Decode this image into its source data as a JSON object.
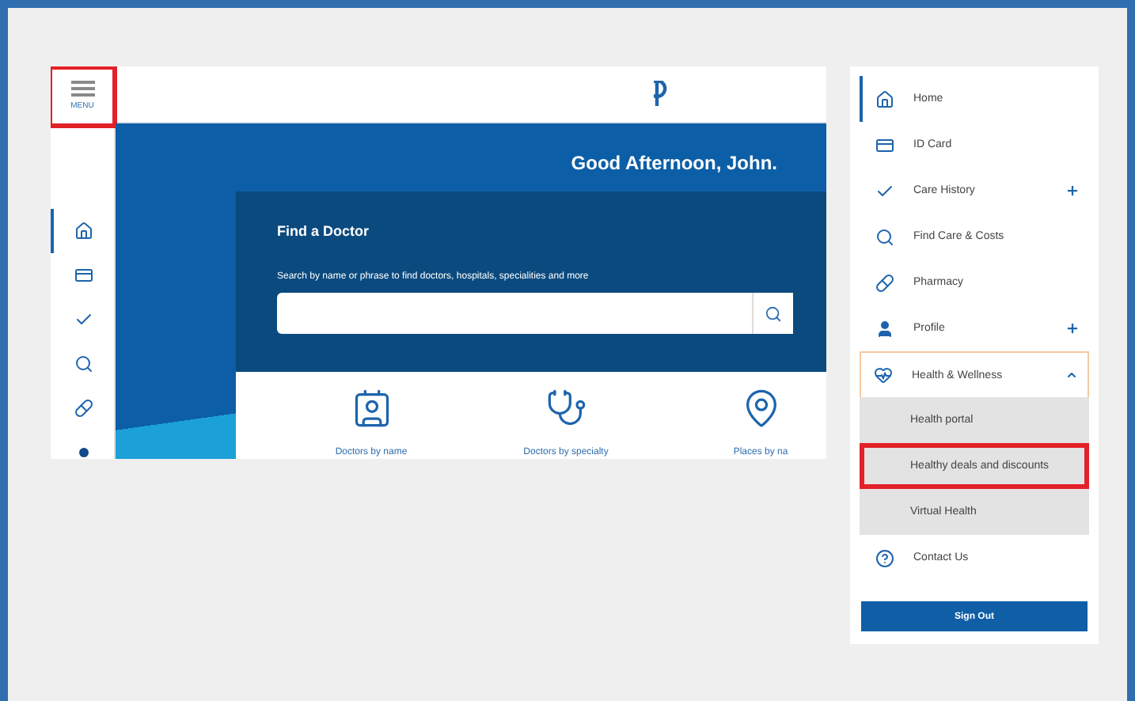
{
  "app_screen": {
    "menu_button": {
      "label": "MENU",
      "highlighted": true
    },
    "rail": [
      {
        "kind": "home",
        "selected": true
      },
      {
        "kind": "card",
        "selected": false
      },
      {
        "kind": "check",
        "selected": false
      },
      {
        "kind": "search",
        "selected": false
      },
      {
        "kind": "pharmacy",
        "selected": false
      },
      {
        "kind": "dot",
        "selected": false
      }
    ],
    "greeting": "Good Afternoon, John.",
    "find_doctor": {
      "title": "Find a Doctor",
      "description": "Search by name or phrase to find doctors, hospitals, specialities and more",
      "options": [
        {
          "kind": "badge",
          "label": "Doctors by name"
        },
        {
          "kind": "stethoscope",
          "label": "Doctors by specialty"
        },
        {
          "kind": "pin",
          "label": "Places by na"
        }
      ]
    }
  },
  "menu_panel": {
    "items": [
      {
        "kind": "home",
        "label": "Home",
        "selected": true
      },
      {
        "kind": "card",
        "label": "ID Card",
        "selected": false
      },
      {
        "kind": "check",
        "label": "Care History",
        "selected": false,
        "expandable": true,
        "expanded": false
      },
      {
        "kind": "search",
        "label": "Find Care & Costs",
        "selected": false
      },
      {
        "kind": "pharmacy",
        "label": "Pharmacy",
        "selected": false
      },
      {
        "kind": "user",
        "label": "Profile",
        "selected": false,
        "expandable": true,
        "expanded": false
      },
      {
        "kind": "heart",
        "label": "Health & Wellness",
        "selected": false,
        "expandable": true,
        "expanded": true,
        "children": [
          {
            "label": "Health portal",
            "highlighted": false
          },
          {
            "label": "Healthy deals and discounts",
            "highlighted": true
          },
          {
            "label": "Virtual Health",
            "highlighted": false
          }
        ]
      },
      {
        "kind": "help",
        "label": "Contact Us",
        "selected": false
      }
    ],
    "sign_out": "Sign Out"
  }
}
